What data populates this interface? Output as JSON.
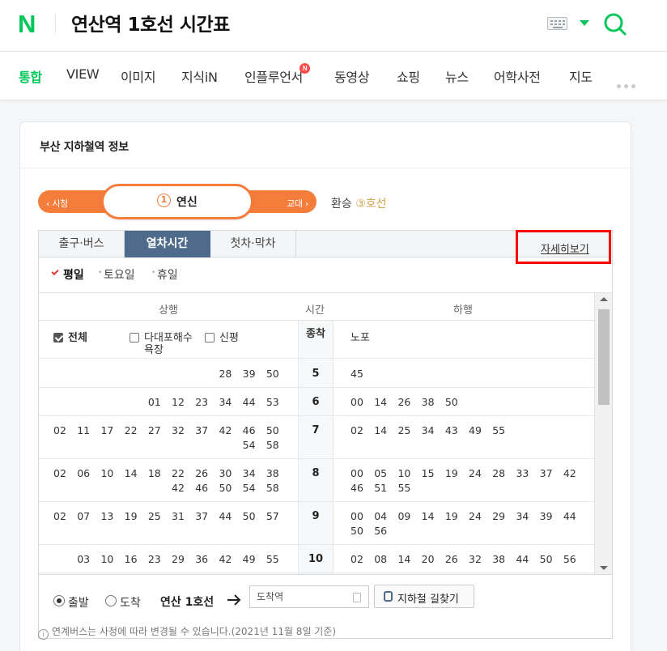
{
  "header": {
    "logo": "N",
    "query": "연산역 1호선 시간표"
  },
  "tabs": [
    {
      "label": "통합",
      "active": true
    },
    {
      "label": "VIEW"
    },
    {
      "label": "이미지"
    },
    {
      "label": "지식iN"
    },
    {
      "label": "인플루언서",
      "badge": "N"
    },
    {
      "label": "동영상"
    },
    {
      "label": "쇼핑"
    },
    {
      "label": "뉴스"
    },
    {
      "label": "어학사전"
    },
    {
      "label": "지도"
    }
  ],
  "card": {
    "title": "부산 지하철역 정보",
    "station": {
      "prev": "‹ 시청",
      "next": "교대 ›",
      "num": "1",
      "name": "연신"
    },
    "transfer": {
      "label": "환승",
      "line": "③호선"
    },
    "subtabs": [
      "출구·버스",
      "열차시간",
      "첫차·막차"
    ],
    "days": [
      "평일",
      "토요일",
      "휴일"
    ],
    "detail_link": "자세히보기",
    "header": {
      "up": "상행",
      "time": "시간",
      "down": "하행"
    },
    "filters": {
      "all": "전체",
      "opt1": "다대포해수",
      "opt1b": "욕장",
      "opt2": "신평",
      "terminal_label": "종착",
      "down_dest": "노포"
    },
    "rows": [
      {
        "hour": "5",
        "up": [
          "28",
          "39",
          "50"
        ],
        "down": [
          "45"
        ]
      },
      {
        "hour": "6",
        "up": [
          "01",
          "12",
          "23",
          "34",
          "44",
          "53"
        ],
        "down": [
          "00",
          "14",
          "26",
          "38",
          "50"
        ]
      },
      {
        "hour": "7",
        "up": [
          "02",
          "11",
          "17",
          "22",
          "27",
          "32",
          "37",
          "42",
          "46",
          "50",
          "54",
          "58"
        ],
        "down": [
          "02",
          "14",
          "25",
          "34",
          "43",
          "49",
          "55"
        ]
      },
      {
        "hour": "8",
        "up": [
          "02",
          "06",
          "10",
          "14",
          "18",
          "22",
          "26",
          "30",
          "34",
          "38",
          "42",
          "46",
          "50",
          "54",
          "58"
        ],
        "down": [
          "00",
          "05",
          "10",
          "15",
          "19",
          "24",
          "28",
          "33",
          "37",
          "42",
          "46",
          "51",
          "55"
        ]
      },
      {
        "hour": "9",
        "up": [
          "02",
          "07",
          "13",
          "19",
          "25",
          "31",
          "37",
          "44",
          "50",
          "57"
        ],
        "down": [
          "00",
          "04",
          "09",
          "14",
          "19",
          "24",
          "29",
          "34",
          "39",
          "44",
          "50",
          "56"
        ]
      },
      {
        "hour": "10",
        "up": [
          "03",
          "10",
          "16",
          "23",
          "29",
          "36",
          "42",
          "49",
          "55"
        ],
        "down": [
          "02",
          "08",
          "14",
          "20",
          "26",
          "32",
          "38",
          "44",
          "50",
          "56"
        ]
      }
    ],
    "route": {
      "depart": "출발",
      "arrive": "도착",
      "line": "연산 1호선",
      "dest_placeholder": "도착역",
      "button": "지하철 길찾기"
    },
    "notice": "연계버스는 사정에 따라 변경될 수 있습니다.(2021년 11월 8일 기준)"
  }
}
